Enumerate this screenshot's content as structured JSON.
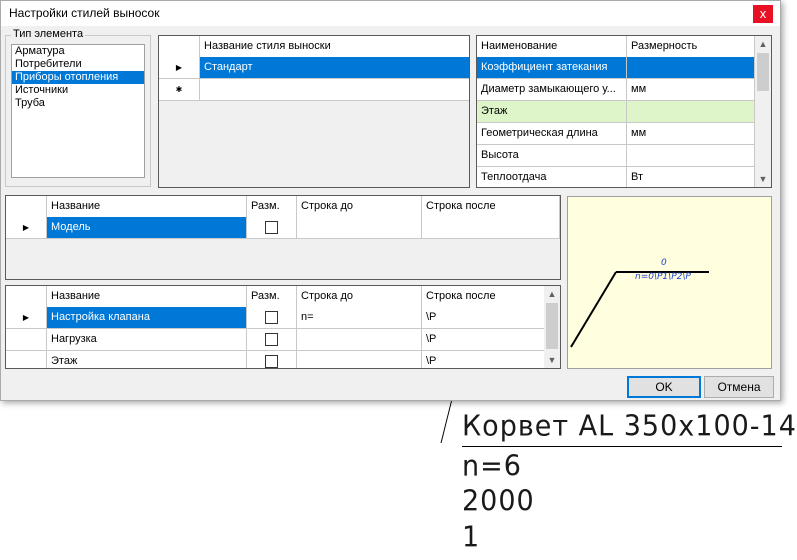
{
  "background_drawing": {
    "line1": "Корвет AL 350x100-14",
    "line2": "n=6",
    "line3": "2000",
    "line4": "1"
  },
  "window": {
    "title": "Настройки стилей выносок",
    "close_glyph": "x"
  },
  "element_type": {
    "group_title": "Тип элемента",
    "items": [
      "Арматура",
      "Потребители",
      "Приборы отопления",
      "Источники",
      "Труба"
    ],
    "selected": "Приборы отопления"
  },
  "styles_grid": {
    "header": "Название стиля выноски",
    "rows": [
      "Стандарт",
      ""
    ],
    "row_markers": [
      "▶",
      "✱"
    ]
  },
  "params_grid": {
    "headers": [
      "Наименование",
      "Размерность"
    ],
    "rows": [
      {
        "name": "Коэффициент затекания",
        "unit": "",
        "state": "selected"
      },
      {
        "name": "Диаметр замыкающего у...",
        "unit": "мм",
        "state": ""
      },
      {
        "name": "Этаж",
        "unit": "",
        "state": "highlight"
      },
      {
        "name": "Геометрическая длина",
        "unit": "мм",
        "state": ""
      },
      {
        "name": "Высота",
        "unit": "",
        "state": ""
      },
      {
        "name": "Теплоотдача",
        "unit": "Вт",
        "state": ""
      }
    ]
  },
  "top_fields_grid": {
    "headers": [
      "Название",
      "Разм.",
      "Строка до",
      "Строка после"
    ],
    "rows": [
      {
        "marker": "▶",
        "name": "Модель",
        "checked": false,
        "before": "",
        "after": ""
      }
    ]
  },
  "bottom_fields_grid": {
    "headers": [
      "Название",
      "Разм.",
      "Строка до",
      "Строка после"
    ],
    "rows": [
      {
        "marker": "▶",
        "name": "Настройка клапана",
        "checked": false,
        "before": "n=",
        "after": "\\P"
      },
      {
        "marker": "",
        "name": "Нагрузка",
        "checked": false,
        "before": "",
        "after": "\\P"
      },
      {
        "marker": "",
        "name": "Этаж",
        "checked": false,
        "before": "",
        "after": "\\P"
      }
    ]
  },
  "preview": {
    "line1": "0",
    "line2": "n=0\\P1\\P2\\P"
  },
  "buttons": {
    "ok": "OK",
    "cancel": "Отмена"
  },
  "colors": {
    "selection": "#0078d7",
    "highlight_row": "#ddf5c9",
    "preview_bg": "#ffffe0",
    "close_button": "#e81123"
  }
}
